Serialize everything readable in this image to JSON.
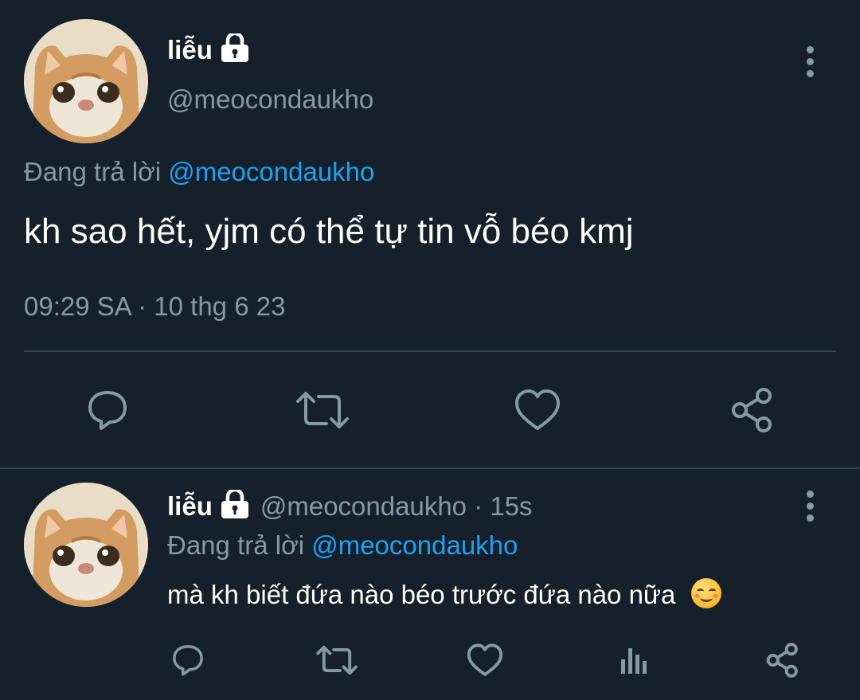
{
  "main_tweet": {
    "display_name": "liễu",
    "handle": "@meocondaukho",
    "reply_prefix": "Đang trả lời",
    "reply_mention": "@meocondaukho",
    "text": "kh sao hết, yjm có thể tự tin vỗ béo kmj",
    "timestamp": "09:29 SA · 10 thg 6 23",
    "actions": [
      "reply-icon",
      "retweet-icon",
      "like-icon",
      "share-icon"
    ]
  },
  "reply_tweet": {
    "display_name": "liễu",
    "handle_time": "@meocondaukho · 15s",
    "reply_prefix": "Đang trả lời",
    "reply_mention": "@meocondaukho",
    "text": "mà kh biết đứa nào béo trước đứa nào nữa",
    "emoji": "smiling-face-emoji",
    "actions": [
      "reply-icon",
      "retweet-icon",
      "like-icon",
      "analytics-icon",
      "share-icon"
    ]
  },
  "colors": {
    "background": "#15202b",
    "text": "#ffffff",
    "secondary": "#8899a6",
    "accent": "#1da1f2",
    "divider": "#38444d"
  }
}
